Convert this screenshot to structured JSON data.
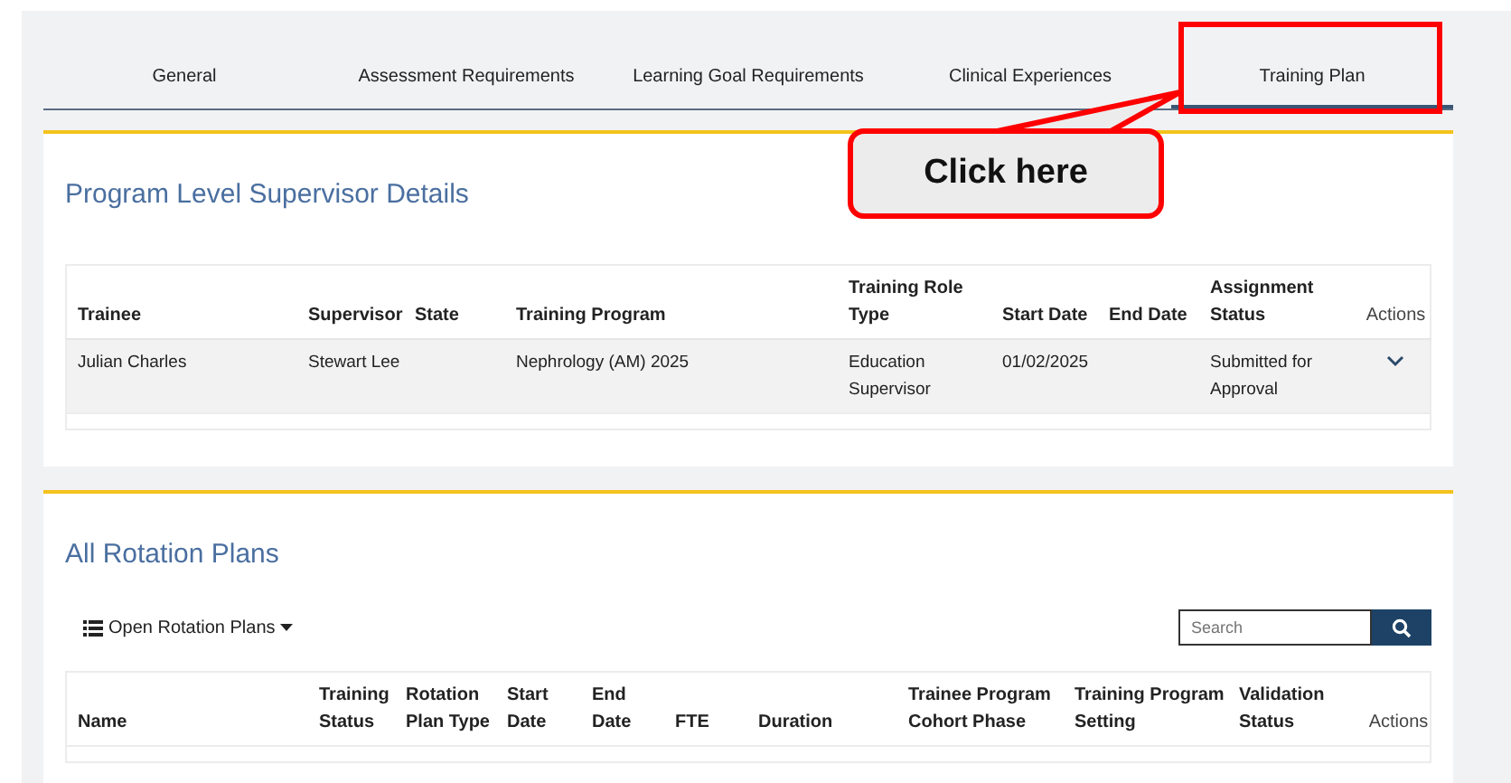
{
  "tabs": [
    {
      "label": "General",
      "selected": false
    },
    {
      "label": "Assessment Requirements",
      "selected": false
    },
    {
      "label": "Learning Goal Requirements",
      "selected": false
    },
    {
      "label": "Clinical Experiences",
      "selected": false
    },
    {
      "label": "Training Plan",
      "selected": true
    }
  ],
  "callout": {
    "label": "Click here"
  },
  "supervisor_details": {
    "title": "Program Level Supervisor Details",
    "columns": [
      "Trainee",
      "Supervisor",
      "State",
      "Training Program",
      "Training Role Type",
      "Start Date",
      "End Date",
      "Assignment Status",
      "Actions"
    ],
    "rows": [
      {
        "cells": [
          "Julian Charles",
          "Stewart Lee",
          "",
          "Nephrology (AM) 2025",
          "Education Supervisor",
          "01/02/2025",
          "",
          "Submitted for Approval"
        ]
      }
    ]
  },
  "rotation_plans": {
    "title": "All Rotation Plans",
    "filter": "Open Rotation Plans",
    "search": {
      "placeholder": "Search"
    },
    "columns": [
      "Name",
      "Training Status",
      "Rotation Plan Type",
      "Start Date",
      "End Date",
      "FTE",
      "Duration",
      "Trainee Program Cohort Phase",
      "Training Program Setting",
      "Validation Status",
      "Actions"
    ]
  }
}
